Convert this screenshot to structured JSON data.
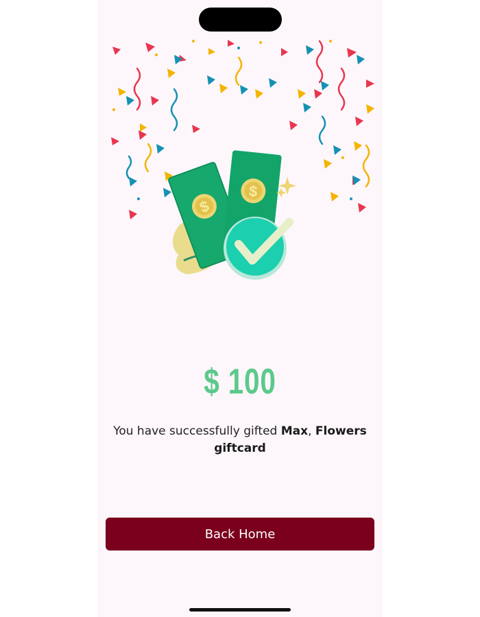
{
  "gift": {
    "amount": "$ 100",
    "message_prefix": "You have successfully gifted ",
    "recipient": "Max",
    "separator": ", ",
    "card_name": "Flowers giftcard"
  },
  "actions": {
    "back_home_label": "Back Home"
  },
  "colors": {
    "amount": "#5cc98b",
    "button": "#7a001d",
    "background": "#fdf7fb",
    "confetti": [
      "#e8364f",
      "#f4b400",
      "#1591b3"
    ]
  },
  "icons": [
    "success-illustration",
    "confetti-decoration",
    "dollar-bill-icon",
    "checkmark-icon"
  ]
}
